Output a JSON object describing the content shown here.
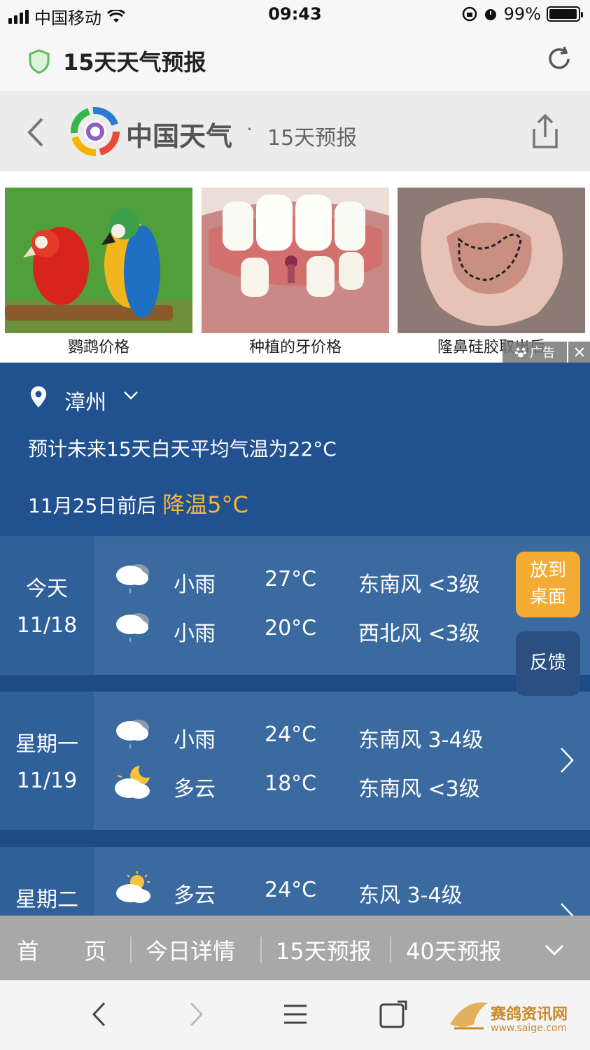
{
  "status_bar": {
    "carrier": "中国移动",
    "time": "09:43",
    "battery": "99%"
  },
  "url_bar": {
    "title": "15天天气预报"
  },
  "site_header": {
    "brand": "中国天气",
    "separator": "·",
    "section": "15天预报"
  },
  "ads": {
    "items": [
      {
        "caption": "鹦鹉价格"
      },
      {
        "caption": "种植的牙价格"
      },
      {
        "caption": "隆鼻硅胶取出后"
      }
    ],
    "tag": "广告"
  },
  "summary": {
    "city": "漳州",
    "avg_text": "预计未来15天白天平均气温为22°C",
    "date_text": "11月25日前后",
    "cooling_text": "降温5°C"
  },
  "forecast": {
    "days": [
      {
        "name": "今天",
        "date": "11/18",
        "day": {
          "icon": "light-rain-icon",
          "cond": "小雨",
          "temp": "27°C",
          "wind": "东南风 <3级"
        },
        "night": {
          "icon": "light-rain-icon",
          "cond": "小雨",
          "temp": "20°C",
          "wind": "西北风 <3级"
        }
      },
      {
        "name": "星期一",
        "date": "11/19",
        "day": {
          "icon": "light-rain-icon",
          "cond": "小雨",
          "temp": "24°C",
          "wind": "东南风 3-4级"
        },
        "night": {
          "icon": "cloudy-night-icon",
          "cond": "多云",
          "temp": "18°C",
          "wind": "东南风 <3级"
        }
      },
      {
        "name": "星期二",
        "day": {
          "icon": "partly-cloudy-icon",
          "cond": "多云",
          "temp": "24°C",
          "wind": "东风 3-4级"
        }
      }
    ]
  },
  "float_buttons": {
    "desktop": "放到桌面",
    "feedback": "反馈"
  },
  "bottom_nav": {
    "home": "首　　页",
    "today": "今日详情",
    "day15": "15天预报",
    "day40": "40天预报"
  },
  "watermark": {
    "name": "赛鸽资讯网",
    "url": "www.saige.com"
  },
  "colors": {
    "header_blue": "#21518f",
    "row_blue": "#3a6aa0",
    "accent_orange": "#f3ab33",
    "cooling_orange": "#f5b63d"
  }
}
